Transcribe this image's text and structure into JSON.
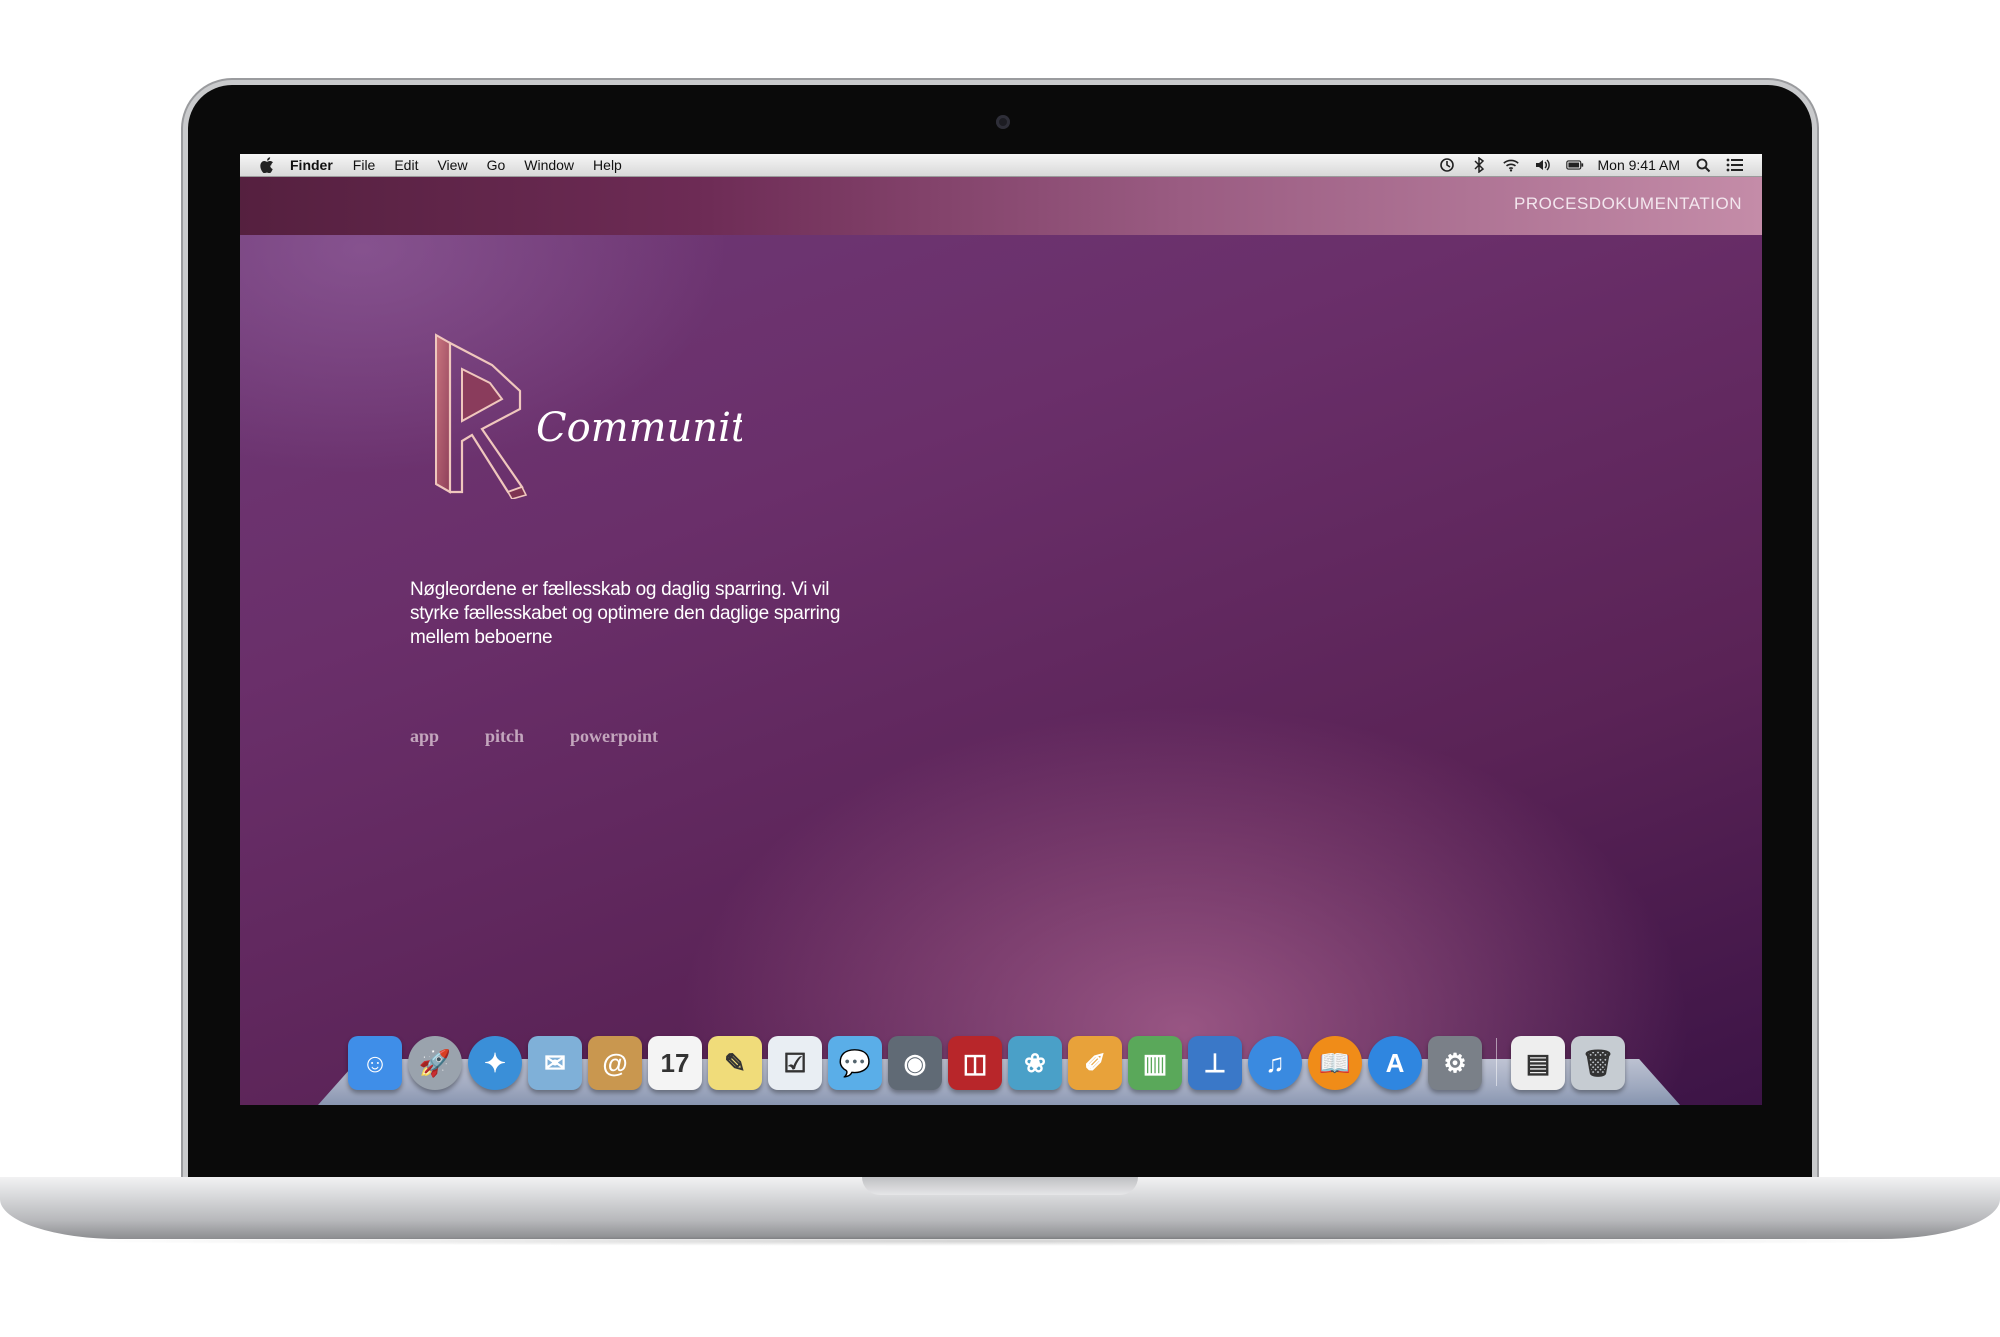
{
  "menubar": {
    "app_name": "Finder",
    "items": [
      "File",
      "Edit",
      "View",
      "Go",
      "Window",
      "Help"
    ],
    "clock": "Mon 9:41 AM",
    "status_icons": [
      "time-machine-icon",
      "bluetooth-icon",
      "wifi-icon",
      "volume-icon",
      "battery-icon",
      "spotlight-icon",
      "notifications-icon"
    ]
  },
  "site": {
    "header_link": "PROCESDOKUMENTATION",
    "logo_letter": "R",
    "logo_word": "Community",
    "intro": "Nøgleordene er fællesskab og daglig sparring. Vi vil styrke fællesskabet og optimere den daglige sparring mellem beboerne",
    "nav": [
      "app",
      "pitch",
      "powerpoint"
    ],
    "colors": {
      "background": "#5f2660",
      "header_band_end": "#c48ca8",
      "nav_link": "#c3a6bd",
      "logo_stroke": "#f0c7bd"
    }
  },
  "dock": {
    "calendar_day": "17",
    "apps": [
      {
        "name": "finder-icon",
        "glyph": "☺",
        "color": "#3f8ee8"
      },
      {
        "name": "launchpad-icon",
        "glyph": "🚀",
        "color": "#9aa3ad"
      },
      {
        "name": "safari-icon",
        "glyph": "✦",
        "color": "#3a8fd8"
      },
      {
        "name": "mail-icon",
        "glyph": "✉",
        "color": "#7fb0d8"
      },
      {
        "name": "contacts-icon",
        "glyph": "@",
        "color": "#c9974f"
      },
      {
        "name": "calendar-icon",
        "glyph": "17",
        "color": "#f4f4f4"
      },
      {
        "name": "notes-icon",
        "glyph": "✎",
        "color": "#f0dc7a"
      },
      {
        "name": "reminders-icon",
        "glyph": "☑",
        "color": "#e9eef3"
      },
      {
        "name": "messages-icon",
        "glyph": "💬",
        "color": "#5aaee8"
      },
      {
        "name": "facetime-icon",
        "glyph": "◉",
        "color": "#606a75"
      },
      {
        "name": "photo-booth-icon",
        "glyph": "◫",
        "color": "#b8262a"
      },
      {
        "name": "iphoto-icon",
        "glyph": "❀",
        "color": "#4aa0c8"
      },
      {
        "name": "pages-icon",
        "glyph": "✐",
        "color": "#e8a23a"
      },
      {
        "name": "numbers-icon",
        "glyph": "▥",
        "color": "#5aa85a"
      },
      {
        "name": "keynote-icon",
        "glyph": "⊥",
        "color": "#3a78c8"
      },
      {
        "name": "itunes-icon",
        "glyph": "♫",
        "color": "#3a8ae0"
      },
      {
        "name": "ibooks-icon",
        "glyph": "📖",
        "color": "#f08c18"
      },
      {
        "name": "app-store-icon",
        "glyph": "A",
        "color": "#2f86e0"
      },
      {
        "name": "system-preferences-icon",
        "glyph": "⚙",
        "color": "#7a8088"
      },
      {
        "name": "document-icon",
        "glyph": "▤",
        "color": "#eeeeee"
      },
      {
        "name": "trash-icon",
        "glyph": "🗑",
        "color": "#c6ccd2"
      }
    ]
  }
}
